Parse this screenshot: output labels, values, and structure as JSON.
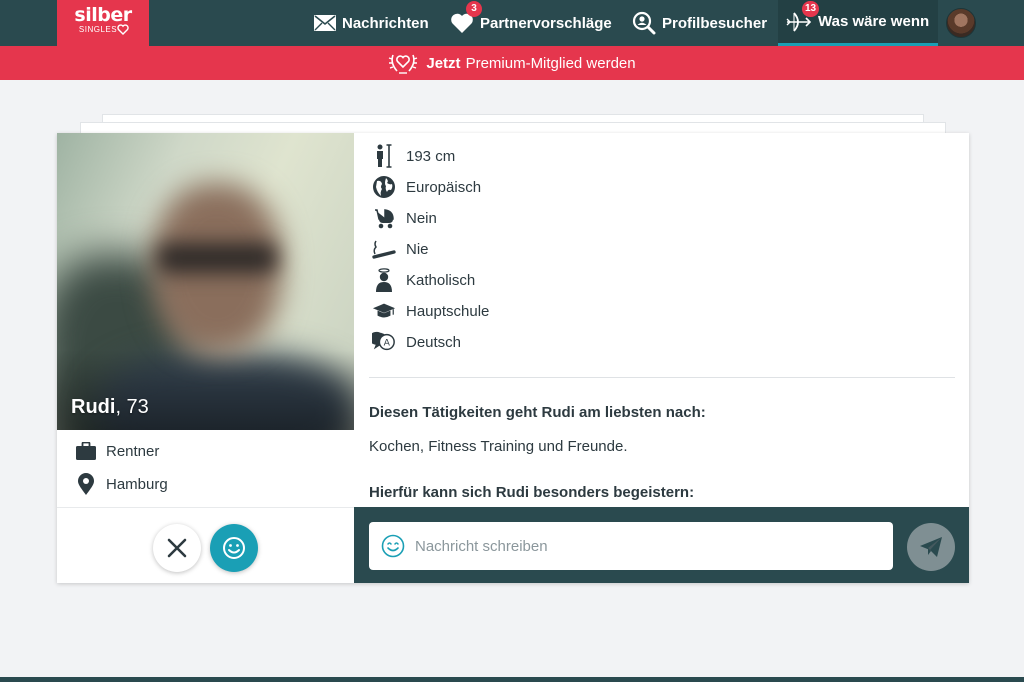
{
  "brand": {
    "name": "silber",
    "sub": "SINGLES"
  },
  "nav": {
    "items": [
      {
        "label": "Nachrichten",
        "icon": "envelope-icon"
      },
      {
        "label": "Partnervorschläge",
        "icon": "heart-icon",
        "badge": "3"
      },
      {
        "label": "Profilbesucher",
        "icon": "visitor-search-icon"
      },
      {
        "label": "Was wäre wenn",
        "icon": "bow-arrow-icon",
        "badge": "13"
      }
    ]
  },
  "premium": {
    "bold": "Jetzt",
    "text": "Premium-Mitglied werden"
  },
  "profile": {
    "name": "Rudi",
    "age": ", 73",
    "job": "Rentner",
    "city": "Hamburg",
    "attributes": [
      {
        "icon": "height-icon",
        "value": "193 cm"
      },
      {
        "icon": "globe-icon",
        "value": "Europäisch"
      },
      {
        "icon": "stroller-icon",
        "value": "Nein"
      },
      {
        "icon": "cigarette-icon",
        "value": "Nie"
      },
      {
        "icon": "religion-icon",
        "value": "Katholisch"
      },
      {
        "icon": "graduation-cap-icon",
        "value": "Hauptschule"
      },
      {
        "icon": "language-bubble-icon",
        "value": "Deutsch"
      }
    ],
    "activities_heading": "Diesen Tätigkeiten geht Rudi am liebsten nach:",
    "activities_text": "Kochen, Fitness Training und Freunde.",
    "interests_heading": "Hierfür kann sich Rudi besonders begeistern:"
  },
  "message": {
    "placeholder": "Nachricht schreiben"
  },
  "colors": {
    "brand_red": "#e5364d",
    "nav_dark": "#2a4a4f",
    "accent_teal": "#1a9fb5"
  }
}
